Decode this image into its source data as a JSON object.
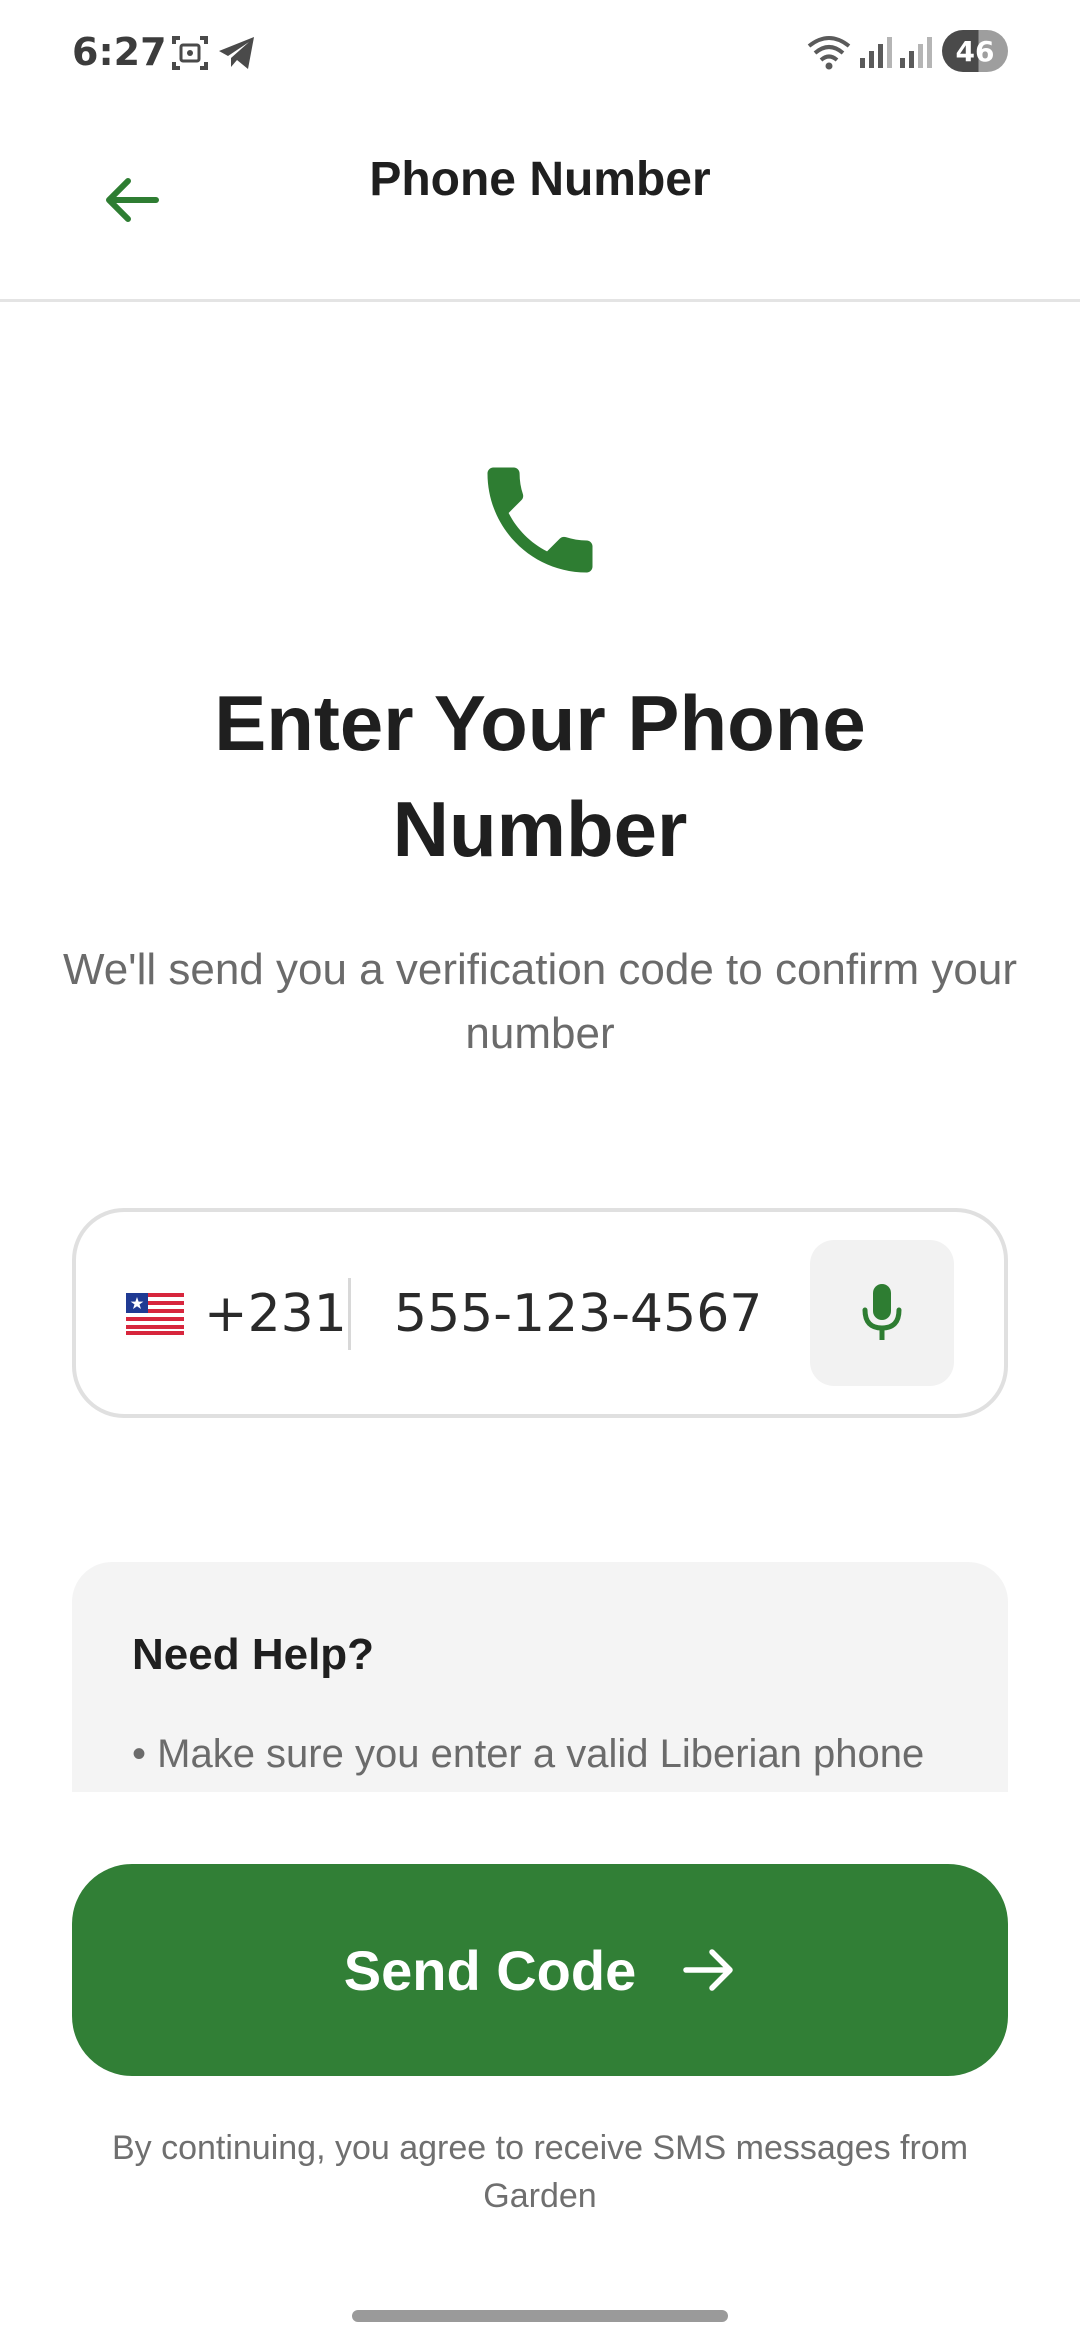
{
  "status_bar": {
    "time": "6:27",
    "battery": "46"
  },
  "header": {
    "title": "Phone Number"
  },
  "hero": {
    "heading": "Enter Your Phone Number",
    "subtitle": "We'll send you a verification code to confirm your number"
  },
  "phone_input": {
    "country_flag": "liberia-flag",
    "country_code": "+231",
    "value": "555-123-4567"
  },
  "help": {
    "title": "Need Help?",
    "items": [
      "Make sure you enter a valid Liberian phone"
    ]
  },
  "actions": {
    "send_code_label": "Send Code"
  },
  "disclaimer": "By continuing, you agree to receive SMS messages from Garden",
  "colors": {
    "primary_green": "#317f36",
    "icon_green": "#2e7d32",
    "text_dark": "#1f1f1f",
    "text_muted": "#6b6b6b",
    "input_border": "#e0e0e0",
    "card_bg": "#f4f4f4"
  }
}
